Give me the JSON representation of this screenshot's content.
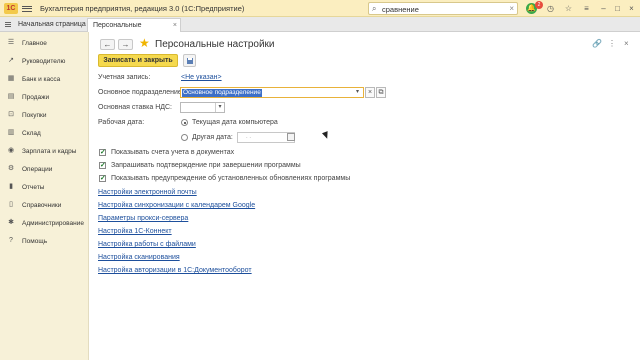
{
  "topbar": {
    "logo_text": "1С",
    "app_title": "Бухгалтерия предприятия, редакция 3.0  (1С:Предприятие)",
    "search_value": "сравнение",
    "notifications_count": "2"
  },
  "tabs": [
    {
      "label": "Начальная страница"
    },
    {
      "label": "Персональные настройки"
    }
  ],
  "sidebar": {
    "items": [
      {
        "label": "Главное",
        "icon": "list-icon"
      },
      {
        "label": "Руководителю",
        "icon": "chart-icon"
      },
      {
        "label": "Банк и касса",
        "icon": "bank-icon"
      },
      {
        "label": "Продажи",
        "icon": "sales-icon"
      },
      {
        "label": "Покупки",
        "icon": "cart-icon"
      },
      {
        "label": "Склад",
        "icon": "warehouse-icon"
      },
      {
        "label": "Зарплата и кадры",
        "icon": "people-icon"
      },
      {
        "label": "Операции",
        "icon": "operations-icon"
      },
      {
        "label": "Отчеты",
        "icon": "reports-icon"
      },
      {
        "label": "Справочники",
        "icon": "book-icon"
      },
      {
        "label": "Администрирование",
        "icon": "gear-icon"
      },
      {
        "label": "Помощь",
        "icon": "help-icon"
      }
    ]
  },
  "main": {
    "title": "Персональные настройки",
    "save_close_label": "Записать и закрыть",
    "account_label": "Учетная запись:",
    "account_value": "<Не указан>",
    "subdivision_label": "Основное подразделение:",
    "subdivision_value": "Основное подразделение",
    "vat_label": "Основная ставка НДС:",
    "vat_value": "",
    "work_date_label": "Рабочая дата:",
    "radio_current": "Текущая дата компьютера",
    "radio_other": "Другая дата:",
    "other_date_placeholder": ". .",
    "checkboxes": [
      {
        "label": "Показывать счета учета в документах",
        "checked": true
      },
      {
        "label": "Запрашивать подтверждение при завершении программы",
        "checked": true
      },
      {
        "label": "Показывать предупреждение об установленных обновлениях программы",
        "checked": true
      }
    ],
    "links": [
      {
        "label": "Настройки электронной почты"
      },
      {
        "label": "Настройка синхронизации с календарем Google"
      },
      {
        "label": "Параметры прокси-сервера"
      },
      {
        "label": "Настройка 1С-Коннект"
      },
      {
        "label": "Настройка работы с файлами"
      },
      {
        "label": "Настройка сканирования"
      },
      {
        "label": "Настройка авторизации в 1С:Документооборот"
      }
    ]
  }
}
